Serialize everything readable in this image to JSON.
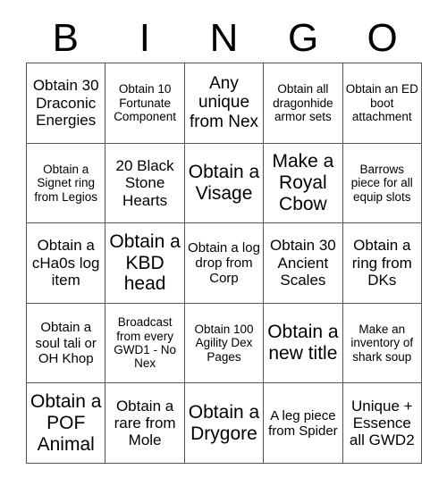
{
  "card": {
    "header_letters": [
      "B",
      "I",
      "N",
      "G",
      "O"
    ],
    "rows": [
      [
        {
          "text": "Obtain 30 Draconic Energies",
          "size": "md"
        },
        {
          "text": "Obtain 10 Fortunate Component",
          "size": "xs"
        },
        {
          "text": "Any unique from Nex",
          "size": "lg"
        },
        {
          "text": "Obtain all dragonhide armor sets",
          "size": "xs"
        },
        {
          "text": "Obtain an ED boot attachment",
          "size": "xs"
        }
      ],
      [
        {
          "text": "Obtain a Signet ring from Legios",
          "size": "xs"
        },
        {
          "text": "20 Black Stone Hearts",
          "size": "md"
        },
        {
          "text": "Obtain a Visage",
          "size": "xl"
        },
        {
          "text": "Make a Royal Cbow",
          "size": "xl"
        },
        {
          "text": "Barrows piece for all equip slots",
          "size": "xs"
        }
      ],
      [
        {
          "text": "Obtain a cHa0s log item",
          "size": "md"
        },
        {
          "text": "Obtain a KBD head",
          "size": "xl"
        },
        {
          "text": "Obtain a log drop from Corp",
          "size": "sm"
        },
        {
          "text": "Obtain 30 Ancient Scales",
          "size": "md"
        },
        {
          "text": "Obtain a ring from DKs",
          "size": "md"
        }
      ],
      [
        {
          "text": "Obtain a soul tali or OH Khop",
          "size": "sm"
        },
        {
          "text": "Broadcast from every GWD1 - No Nex",
          "size": "xs"
        },
        {
          "text": "Obtain 100 Agility Dex Pages",
          "size": "xs"
        },
        {
          "text": "Obtain a new title",
          "size": "xl"
        },
        {
          "text": "Make an inventory of shark soup",
          "size": "xs"
        }
      ],
      [
        {
          "text": "Obtain a POF Animal",
          "size": "xl"
        },
        {
          "text": "Obtain a rare from Mole",
          "size": "md"
        },
        {
          "text": "Obtain a Drygore",
          "size": "xl"
        },
        {
          "text": "A leg piece from Spider",
          "size": "sm"
        },
        {
          "text": "Unique + Essence all GWD2",
          "size": "md"
        }
      ]
    ]
  }
}
